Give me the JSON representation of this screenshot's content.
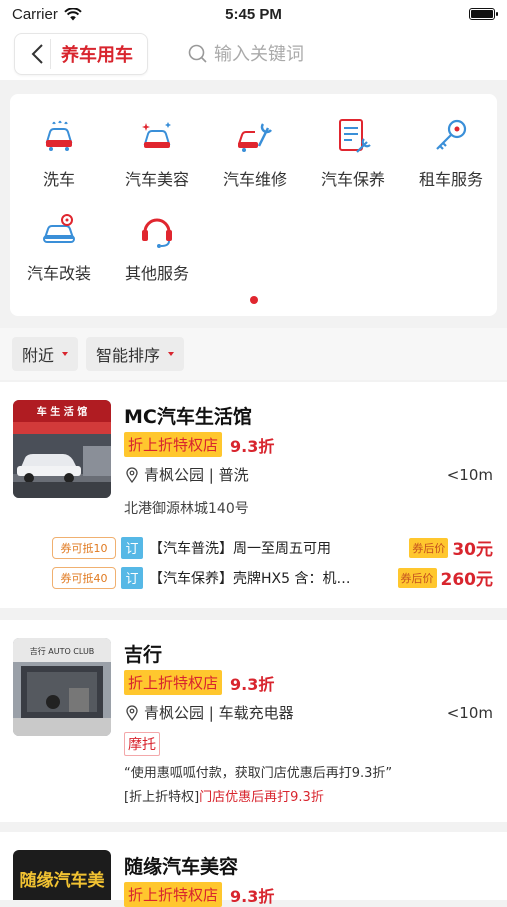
{
  "status_bar": {
    "carrier": "Carrier",
    "time": "5:45 PM"
  },
  "header": {
    "title": "养车用车",
    "search_placeholder": "输入关键词"
  },
  "categories": [
    {
      "label": "洗车",
      "icon": "car-wash-icon"
    },
    {
      "label": "汽车美容",
      "icon": "car-beauty-icon"
    },
    {
      "label": "汽车维修",
      "icon": "car-repair-icon"
    },
    {
      "label": "汽车保养",
      "icon": "car-maintenance-icon"
    },
    {
      "label": "租车服务",
      "icon": "key-icon"
    },
    {
      "label": "汽车改装",
      "icon": "car-modify-icon"
    },
    {
      "label": "其他服务",
      "icon": "headset-icon"
    }
  ],
  "filters": [
    {
      "label": "附近"
    },
    {
      "label": "智能排序"
    }
  ],
  "shops": [
    {
      "name": "MC汽车生活馆",
      "image_text": "车 生 活 馆",
      "badge": "折上折特权店",
      "discount": "9.3折",
      "location": "青枫公园 | 普洗",
      "distance": "<10m",
      "address": "北港御源林城140号",
      "deals": [
        {
          "coupon": "券可抵10",
          "tag": "订",
          "text": "【汽车普洗】周一至周五可用",
          "after_label": "券后价",
          "price": "30元"
        },
        {
          "coupon": "券可抵40",
          "tag": "订",
          "text": "【汽车保养】壳牌HX5 含：机…",
          "after_label": "券后价",
          "price": "260元"
        }
      ]
    },
    {
      "name": "吉行",
      "image_text": "吉行 AUTO CLUB",
      "badge": "折上折特权店",
      "discount": "9.3折",
      "location": "青枫公园 | 车载充电器",
      "distance": "<10m",
      "tag": "摩托",
      "note1": "“使用惠呱呱付款，获取门店优惠后再打9.3折”",
      "note2_prefix": "[折上折特权]",
      "note2_red": "门店优惠后再打9.3折"
    },
    {
      "name": "随缘汽车美容",
      "image_text": "随缘汽车美",
      "badge": "折上折特权店",
      "discount": "9.3折"
    }
  ],
  "colors": {
    "brand_red": "#d8252e",
    "badge_yellow": "#ffc72e",
    "tag_blue": "#56b8e6"
  }
}
